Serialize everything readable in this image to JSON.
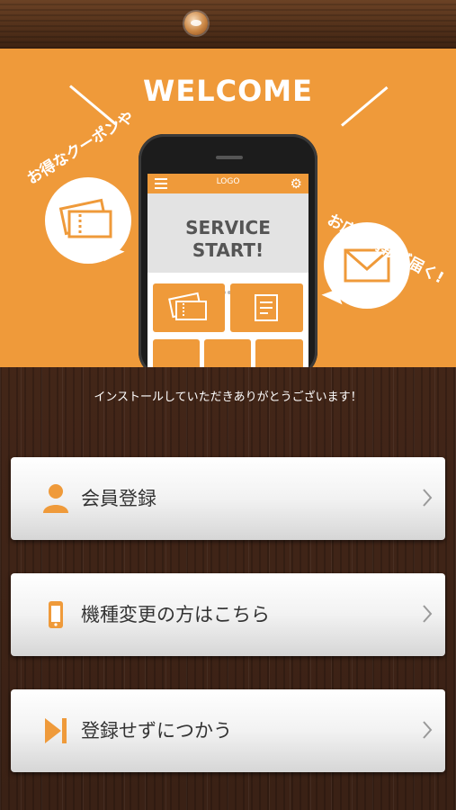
{
  "header": {
    "logo_icon": "brand-logo-icon"
  },
  "hero": {
    "title": "WELCOME",
    "left_bubble_text": "お得なクーポンや",
    "right_bubble_text": "お店の情報が届く!",
    "left_bubble_icon": "ticket-icon",
    "right_bubble_icon": "envelope-icon",
    "phone": {
      "logo_text": "LOGO",
      "service_line1": "SERVICE",
      "service_line2": "START!",
      "menu_icon": "hamburger-icon",
      "settings_icon": "gear-icon"
    },
    "accent_color": "#ef9a3a"
  },
  "thanks_text": "インストールしていただきありがとうございます！",
  "menu": [
    {
      "label": "会員登録",
      "icon": "person-icon"
    },
    {
      "label": "機種変更の方はこちら",
      "icon": "smartphone-icon"
    },
    {
      "label": "登録せずにつかう",
      "icon": "skip-icon"
    }
  ]
}
